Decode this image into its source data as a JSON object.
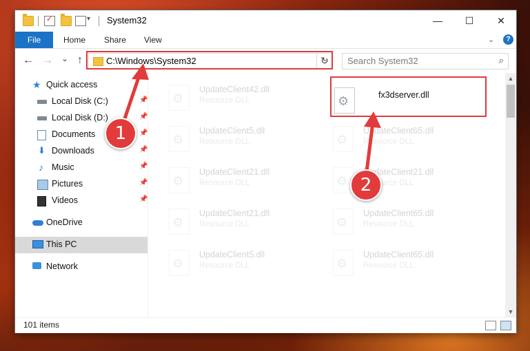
{
  "window": {
    "title": "System32",
    "minimize": "—",
    "maximize": "☐",
    "close": "✕"
  },
  "ribbon": {
    "file": "File",
    "home": "Home",
    "share": "Share",
    "view": "View",
    "help": "?"
  },
  "navigation": {
    "back": "←",
    "forward": "→",
    "recent": "⌄",
    "up": "↑",
    "address": "C:\\Windows\\System32",
    "refresh": "↻",
    "search_placeholder": "Search System32"
  },
  "sidebar": {
    "items": [
      {
        "label": "Quick access",
        "icon": "star-icon"
      },
      {
        "label": "Local Disk (C:)",
        "icon": "drive-icon"
      },
      {
        "label": "Local Disk (D:)",
        "icon": "drive-icon"
      },
      {
        "label": "Documents",
        "icon": "documents-icon"
      },
      {
        "label": "Downloads",
        "icon": "downloads-icon"
      },
      {
        "label": "Music",
        "icon": "music-icon"
      },
      {
        "label": "Pictures",
        "icon": "pictures-icon"
      },
      {
        "label": "Videos",
        "icon": "videos-icon"
      },
      {
        "label": "OneDrive",
        "icon": "cloud-icon"
      },
      {
        "label": "This PC",
        "icon": "computer-icon"
      },
      {
        "label": "Network",
        "icon": "network-icon"
      }
    ]
  },
  "files": [
    {
      "name": "UpdateClient42.dll",
      "type": "Resource DLL"
    },
    {
      "name": "fx3dserver.dll",
      "type": ""
    },
    {
      "name": "UpdateClient5.dll",
      "type": "Resource DLL"
    },
    {
      "name": "UpdateClient65.dll",
      "type": "Resource DLL"
    },
    {
      "name": "UpdateClient21.dll",
      "type": "Resource DLL"
    },
    {
      "name": "UpdateClient21.dll",
      "type": "Resource DLL"
    },
    {
      "name": "UpdateClient21.dll",
      "type": "Resource DLL"
    },
    {
      "name": "UpdateClient65.dll",
      "type": "Resource DLL"
    },
    {
      "name": "UpdateClient5.dll",
      "type": "Resource DLL"
    },
    {
      "name": "UpdateClient65.dll",
      "type": "Resource DLL"
    }
  ],
  "status": {
    "count": "101 items"
  },
  "annotations": {
    "step1": "1",
    "step2": "2",
    "color": "#e03a3a"
  }
}
